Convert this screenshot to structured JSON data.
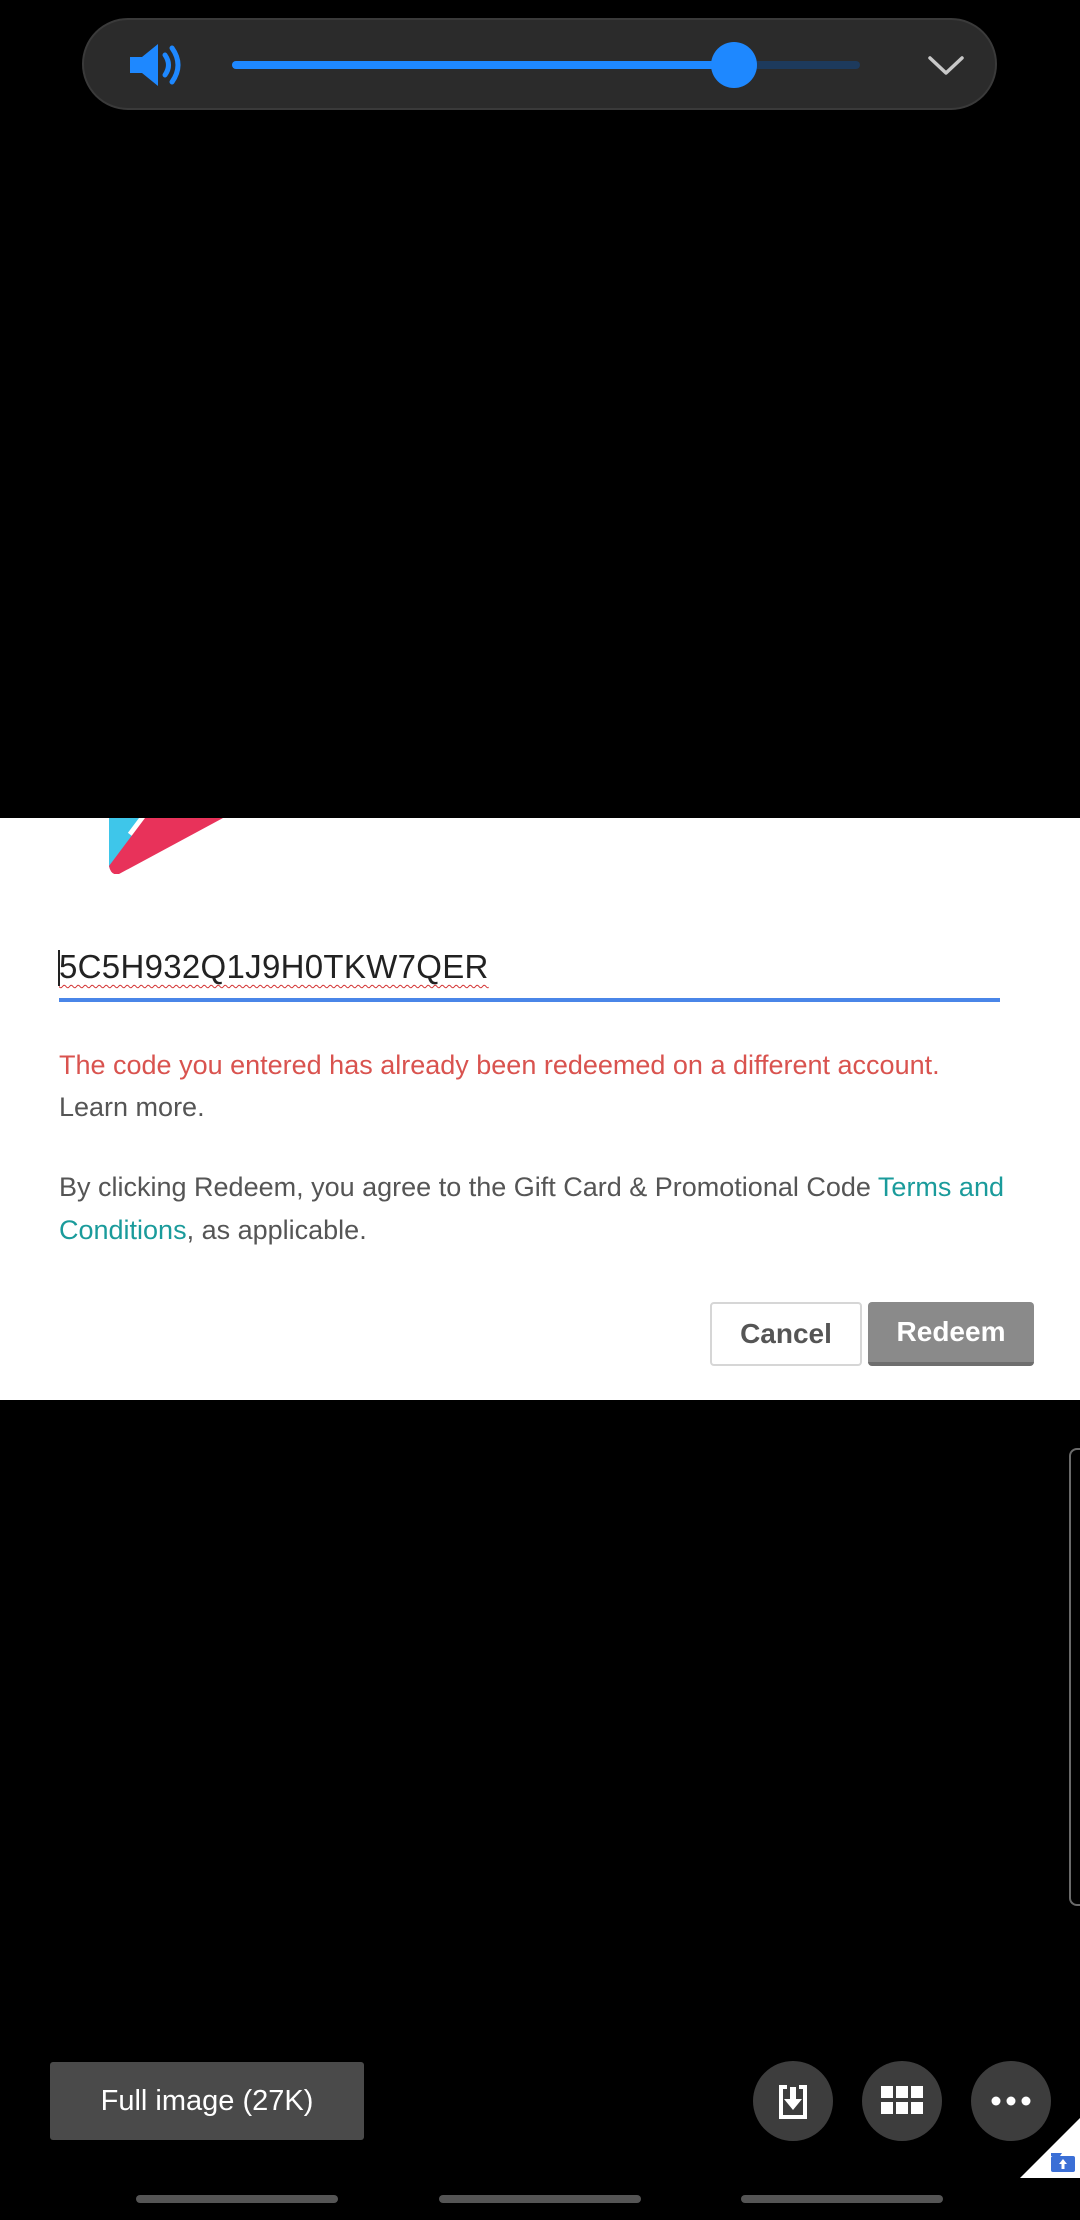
{
  "volume": {
    "level": 0.8,
    "icon": "speaker-icon",
    "expand_icon": "chevron-down-icon",
    "accent_color": "#1e88ff"
  },
  "dialog": {
    "code_value": "5C5H932Q1J9H0TKW7QER",
    "error_message": "The code you entered has already been redeemed on a different account.",
    "learn_more": "Learn more.",
    "terms_prefix": "By clicking Redeem, you agree to the Gift Card & Promotional Code ",
    "terms_link": "Terms and Conditions",
    "terms_suffix": ", as applicable.",
    "cancel_label": "Cancel",
    "redeem_label": "Redeem"
  },
  "viewer": {
    "full_image_label": "Full image (27K)",
    "download_icon": "download-icon",
    "apps_icon": "grid-icon",
    "more_icon": "more-horizontal-icon"
  }
}
